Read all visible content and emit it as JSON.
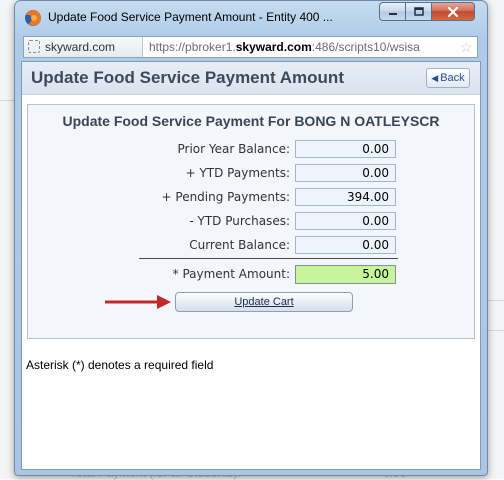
{
  "window": {
    "title": "Update Food Service Payment Amount - Entity 400 ..."
  },
  "address_bar": {
    "site_name": "skyward.com",
    "url_prefix": "https://pbroker1.",
    "url_domain": "skyward.com",
    "url_suffix": ":486/scripts10/wsisa"
  },
  "page": {
    "title": "Update Food Service Payment Amount",
    "back_label": "Back"
  },
  "panel": {
    "title": "Update Food Service Payment For BONG N OATLEYSCR",
    "rows": [
      {
        "label": "Prior Year Balance:",
        "value": "0.00"
      },
      {
        "label": "+ YTD Payments:",
        "value": "0.00"
      },
      {
        "label": "+ Pending Payments:",
        "value": "394.00"
      },
      {
        "label": "- YTD Purchases:",
        "value": "0.00"
      },
      {
        "label": "Current Balance:",
        "value": "0.00"
      }
    ],
    "payment_label": "* Payment Amount:",
    "payment_value": "5.00",
    "update_cart_label": "Update Cart"
  },
  "footer_note": "Asterisk (*) denotes a required field",
  "background": {
    "partial_text": "Total Payment (for all Students):",
    "partial_value": "0.00"
  },
  "colors": {
    "payment_field": "#c8f59a",
    "arrow": "#c0282a",
    "title_text": "#3c4a5c"
  }
}
